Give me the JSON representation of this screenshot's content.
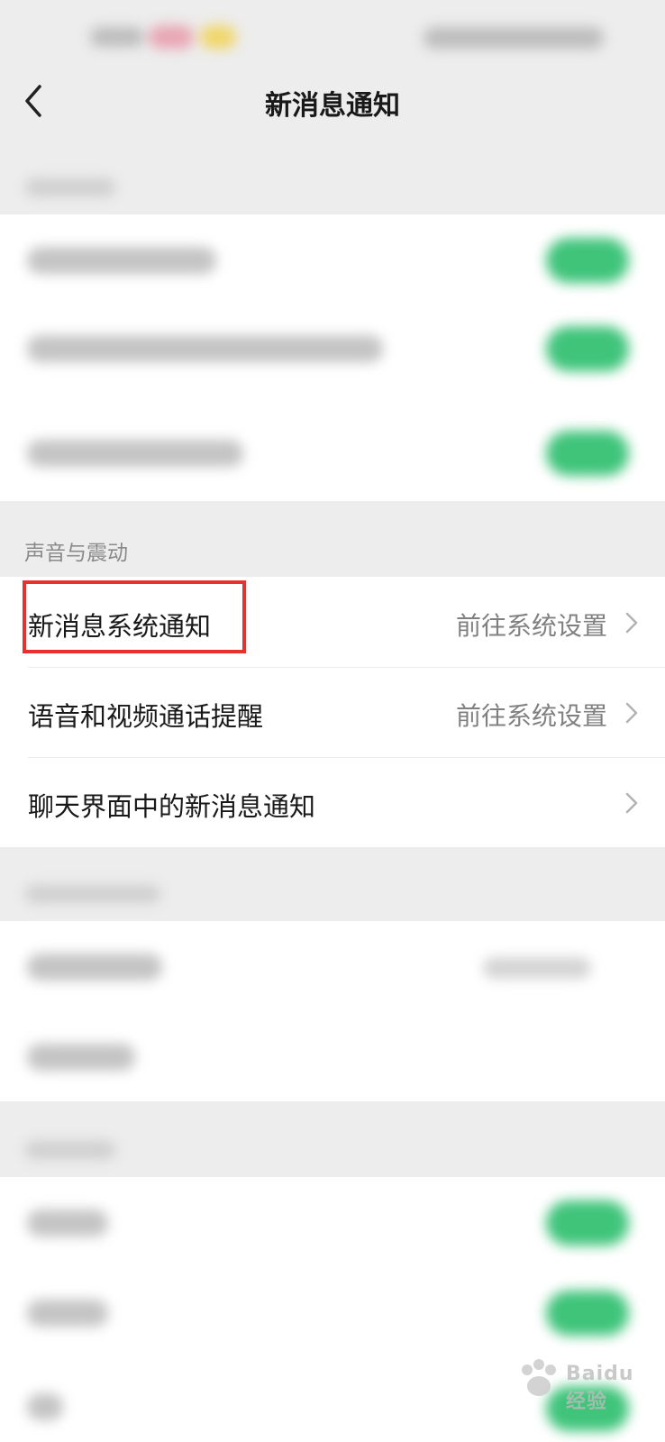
{
  "header": {
    "title": "新消息通知"
  },
  "sections": {
    "sound": {
      "label": "声音与震动",
      "items": [
        {
          "label": "新消息系统通知",
          "value": "前往系统设置"
        },
        {
          "label": "语音和视频通话提醒",
          "value": "前往系统设置"
        },
        {
          "label": "聊天界面中的新消息通知",
          "value": ""
        }
      ]
    }
  },
  "watermark": {
    "brand": "Baidu 经验"
  },
  "colors": {
    "accent": "#3fc47a",
    "highlight": "#e8302e",
    "background": "#ededed"
  },
  "icons": {
    "back": "chevron-left-icon",
    "row_arrow": "chevron-right-icon"
  }
}
